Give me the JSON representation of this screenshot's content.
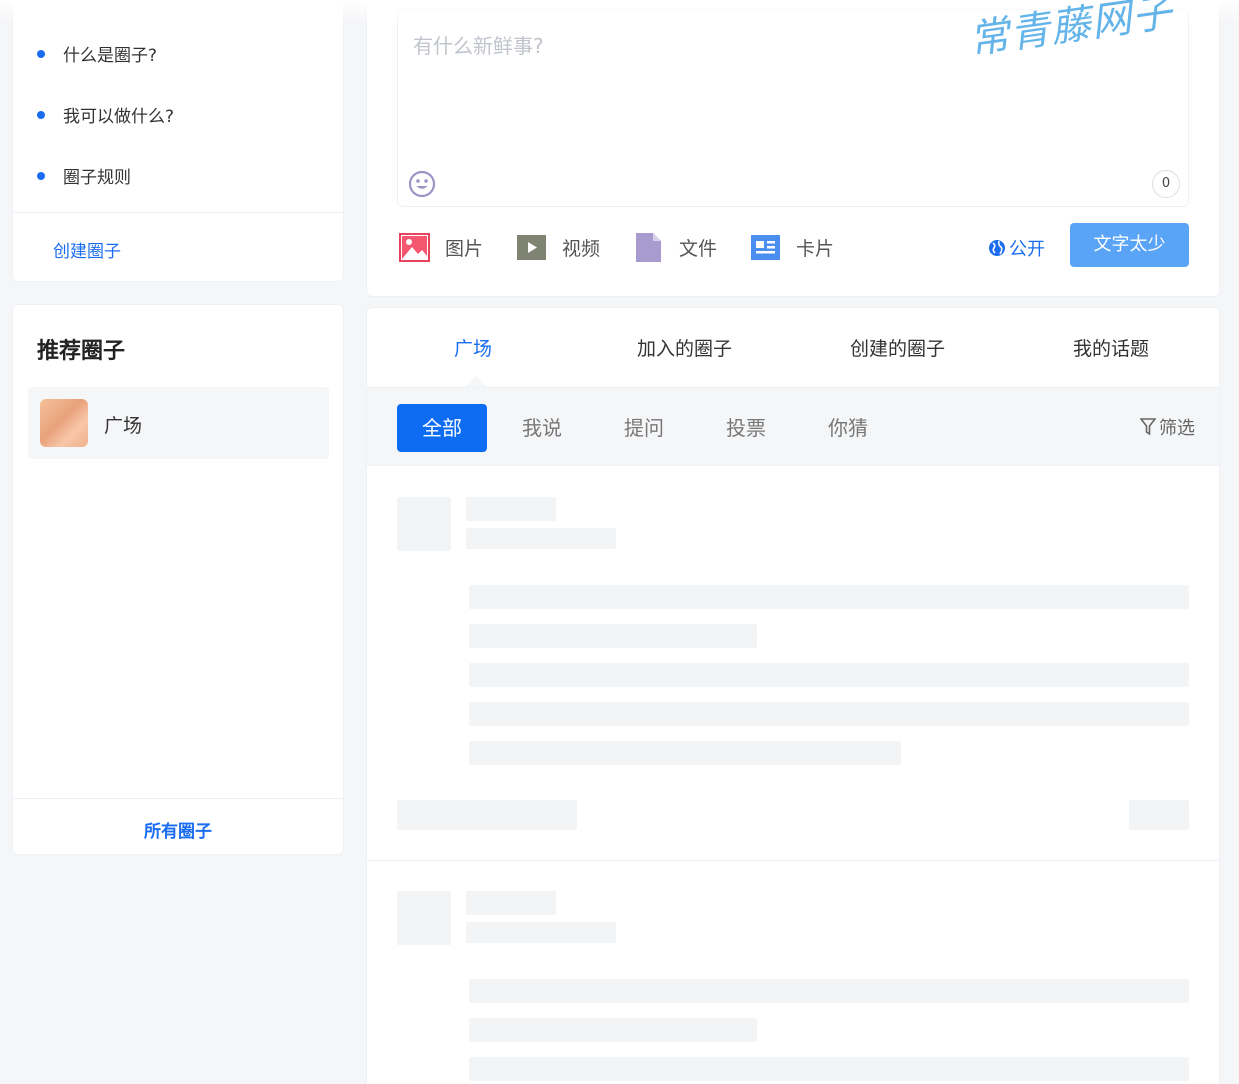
{
  "help": {
    "items": [
      "什么是圈子?",
      "我可以做什么?",
      "圈子规则"
    ],
    "create_label": "创建圈子"
  },
  "recommended": {
    "title": "推荐圈子",
    "items": [
      {
        "name": "广场"
      }
    ],
    "all_label": "所有圈子"
  },
  "composer": {
    "placeholder": "有什么新鲜事?",
    "char_count": "0",
    "tools": [
      {
        "label": "图片",
        "icon": "image-icon"
      },
      {
        "label": "视频",
        "icon": "video-icon"
      },
      {
        "label": "文件",
        "icon": "file-icon"
      },
      {
        "label": "卡片",
        "icon": "card-icon"
      }
    ],
    "visibility_label": "公开",
    "submit_label": "文字太少"
  },
  "feed": {
    "tabs": [
      "广场",
      "加入的圈子",
      "创建的圈子",
      "我的话题"
    ],
    "active_tab": "广场",
    "filters": [
      "全部",
      "我说",
      "提问",
      "投票",
      "你猜"
    ],
    "active_filter": "全部",
    "filter_button_label": "筛选"
  },
  "watermark": "常青藤网子",
  "colors": {
    "accent": "#1a6df0",
    "submit_bg": "#5aa4f8",
    "active_filter_bg": "#0d6cf2",
    "skeleton": "#f3f4f6"
  }
}
